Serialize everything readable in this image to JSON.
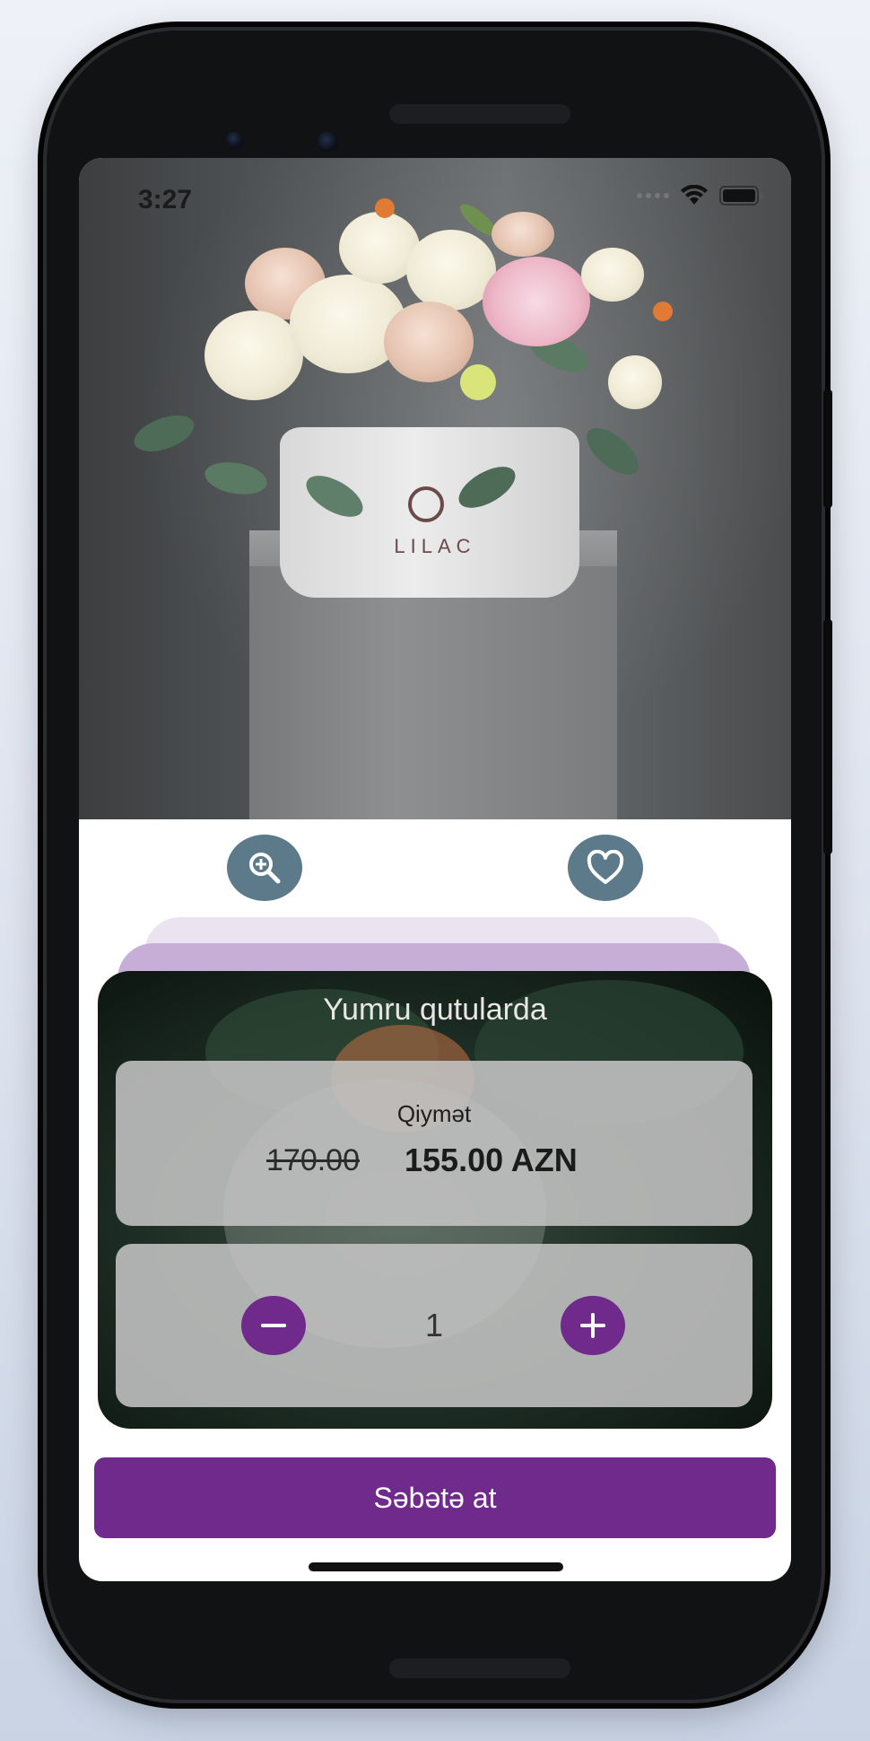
{
  "status_bar": {
    "time": "3:27"
  },
  "hero": {
    "box_logo_text": "LILAC"
  },
  "actions": {
    "zoom_icon": "zoom-in-icon",
    "favorite_icon": "heart-icon"
  },
  "product": {
    "title": "Yumru qutularda",
    "price_label": "Qiymət",
    "old_price": "170.00",
    "new_price": "155.00 AZN"
  },
  "quantity": {
    "value": "1",
    "minus_icon": "minus-icon",
    "plus_icon": "plus-icon"
  },
  "cta": {
    "label": "Səbətə at"
  },
  "colors": {
    "accent": "#6f2a8b",
    "icon_button": "#5c7a8a",
    "panel": "#c4c4c4"
  }
}
